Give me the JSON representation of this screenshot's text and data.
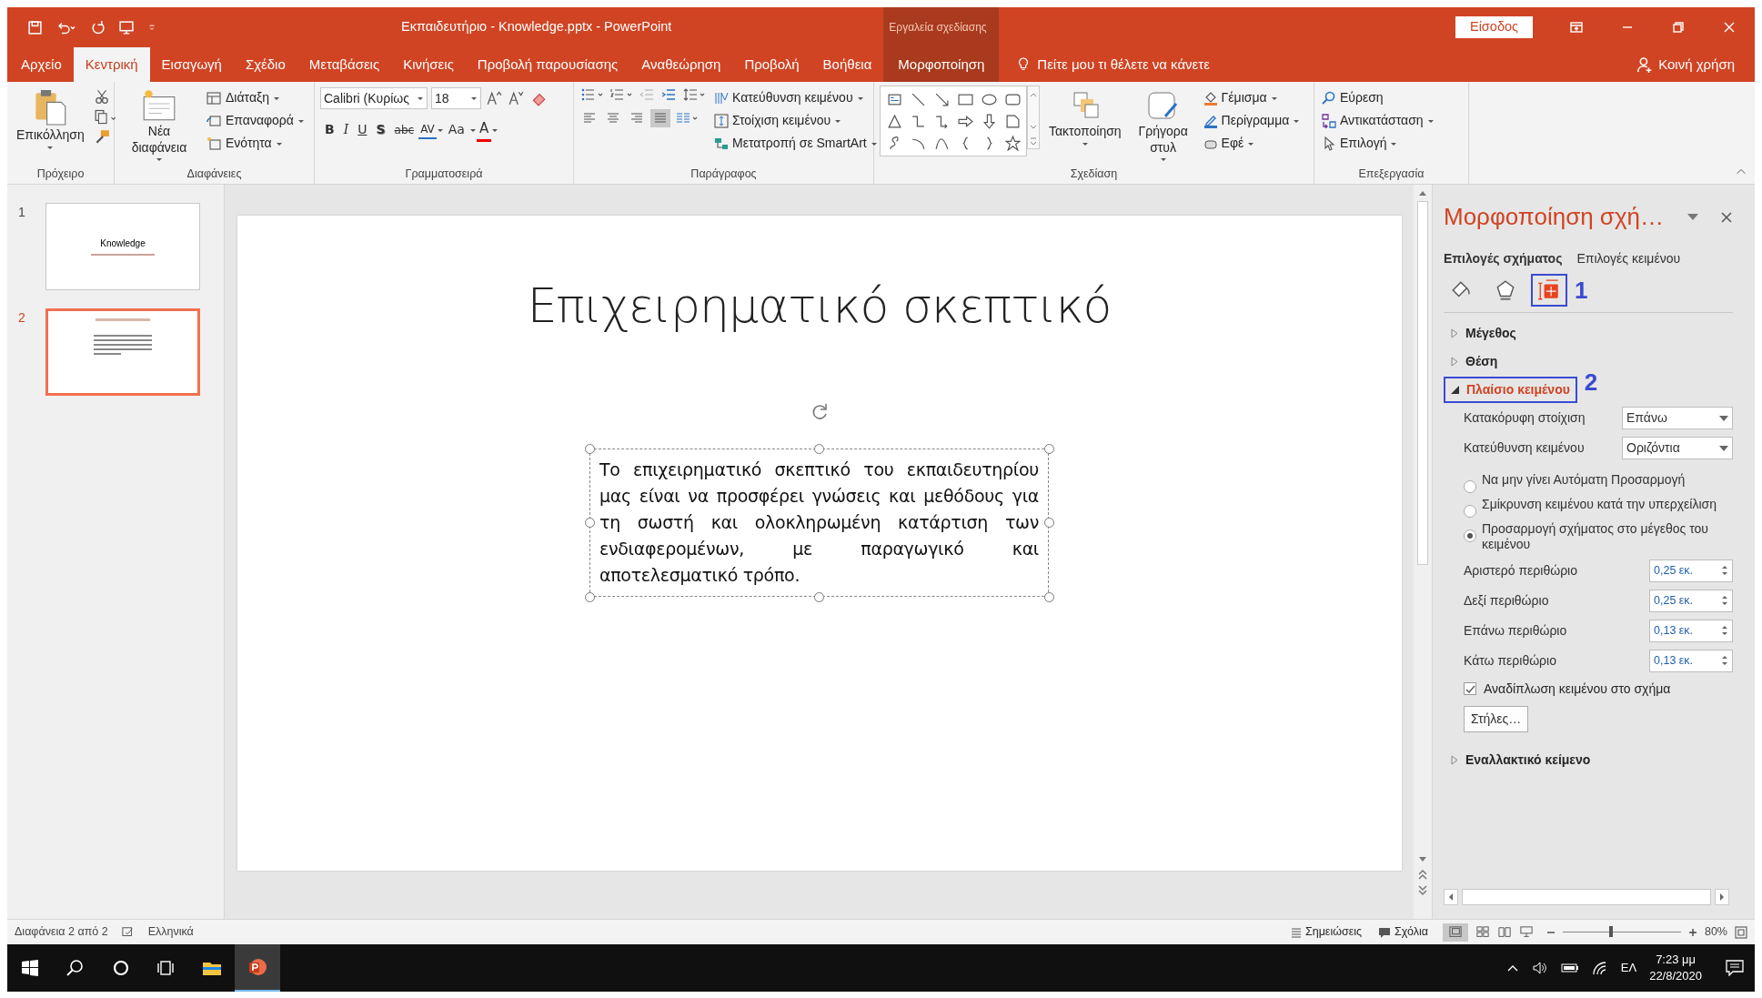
{
  "window": {
    "title": "Εκπαιδευτήριο - Knowledge.pptx  -  PowerPoint",
    "context_group": "Εργαλεία σχεδίασης",
    "sign_in": "Είσοδος"
  },
  "menu_tabs": [
    {
      "label": "Αρχείο",
      "selected": false,
      "kind": "normal"
    },
    {
      "label": "Κεντρική",
      "selected": true,
      "kind": "normal"
    },
    {
      "label": "Εισαγωγή",
      "selected": false,
      "kind": "normal"
    },
    {
      "label": "Σχέδιο",
      "selected": false,
      "kind": "normal"
    },
    {
      "label": "Μεταβάσεις",
      "selected": false,
      "kind": "normal"
    },
    {
      "label": "Κινήσεις",
      "selected": false,
      "kind": "normal"
    },
    {
      "label": "Προβολή παρουσίασης",
      "selected": false,
      "kind": "normal"
    },
    {
      "label": "Αναθεώρηση",
      "selected": false,
      "kind": "normal"
    },
    {
      "label": "Προβολή",
      "selected": false,
      "kind": "normal"
    },
    {
      "label": "Βοήθεια",
      "selected": false,
      "kind": "normal"
    },
    {
      "label": "Μορφοποίηση",
      "selected": false,
      "kind": "contextual"
    }
  ],
  "tell_me": "Πείτε μου τι θέλετε να κάνετε",
  "share": "Κοινή χρήση",
  "ribbon": {
    "clipboard": {
      "name": "Πρόχειρο",
      "paste": "Επικόλληση"
    },
    "slides": {
      "name": "Διαφάνειες",
      "new_slide": "Νέα διαφάνεια",
      "commands": [
        "Διάταξη",
        "Επαναφορά",
        "Ενότητα"
      ]
    },
    "font": {
      "name": "Γραμματοσειρά",
      "font_name": "Calibri (Κυρίως",
      "font_size": "18",
      "format_buttons": [
        {
          "label": "B",
          "kind": "bold"
        },
        {
          "label": "I",
          "kind": "italic"
        },
        {
          "label": "U",
          "kind": "underline"
        },
        {
          "label": "S",
          "kind": "shadow"
        },
        {
          "label": "abc",
          "kind": "strike"
        },
        {
          "label": "AV",
          "kind": "spacing"
        },
        {
          "label": "Aa",
          "kind": "case"
        },
        {
          "label": "A",
          "kind": "color"
        }
      ]
    },
    "paragraph": {
      "name": "Παράγραφος",
      "align_buttons": [
        {
          "selected": false
        },
        {
          "selected": false
        },
        {
          "selected": false
        },
        {
          "selected": true
        }
      ],
      "commands": [
        "Κατεύθυνση κειμένου",
        "Στοίχιση κειμένου",
        "Μετατροπή σε SmartArt"
      ]
    },
    "drawing": {
      "name": "Σχεδίαση",
      "arrange": "Τακτοποίηση",
      "quick_styles": "Γρήγορα στυλ",
      "commands": [
        "Γέμισμα",
        "Περίγραμμα",
        "Εφέ"
      ]
    },
    "editing": {
      "name": "Επεξεργασία",
      "commands": [
        "Εύρεση",
        "Αντικατάσταση",
        "Επιλογή"
      ]
    }
  },
  "slides": [
    {
      "number": "1",
      "selected": false,
      "title": "Knowledge"
    },
    {
      "number": "2",
      "selected": true
    }
  ],
  "slide": {
    "title": "Επιχειρηματικό σκεπτικό",
    "body": "Το επιχειρηματικό σκεπτικό του εκπαιδευτηρίου μας είναι να προσφέρει γνώσεις και μεθόδους για τη σωστή και ολοκληρωμένη κατάρτιση των ενδιαφερομένων, με παραγωγικό και αποτελεσματικό τρόπο."
  },
  "format_pane": {
    "title": "Μορφοποίηση σχή…",
    "tabs": [
      {
        "label": "Επιλογές σχήματος",
        "selected": true
      },
      {
        "label": "Επιλογές κειμένου",
        "selected": false
      }
    ],
    "icon_tabs": [
      {
        "kind": "fill",
        "selected": false
      },
      {
        "kind": "effects",
        "selected": false
      },
      {
        "kind": "size",
        "selected": true,
        "callout": "1"
      }
    ],
    "sections": [
      {
        "label": "Μέγεθος",
        "expanded": false
      },
      {
        "label": "Θέση",
        "expanded": false
      },
      {
        "label": "Πλαίσιο κειμένου",
        "expanded": true,
        "callout": "2"
      },
      {
        "label": "Εναλλακτικό κείμενο",
        "expanded": false
      }
    ],
    "text_box": {
      "dropdowns": [
        {
          "label": "Κατακόρυφη στοίχιση",
          "value": "Επάνω"
        },
        {
          "label": "Κατεύθυνση κειμένου",
          "value": "Οριζόντια"
        }
      ],
      "autofit": [
        {
          "label": "Να μην γίνει Αυτόματη Προσαρμογή",
          "selected": false
        },
        {
          "label": "Σμίκρυνση κειμένου κατά την υπερχείλιση",
          "selected": false
        },
        {
          "label": "Προσαρμογή σχήματος στο μέγεθος του κειμένου",
          "selected": true
        }
      ],
      "margins": [
        {
          "label": "Αριστερό περιθώριο",
          "value": "0,25 εκ."
        },
        {
          "label": "Δεξί περιθώριο",
          "value": "0,25 εκ."
        },
        {
          "label": "Επάνω περιθώριο",
          "value": "0,13 εκ."
        },
        {
          "label": "Κάτω περιθώριο",
          "value": "0,13 εκ."
        }
      ],
      "wrap": {
        "label": "Αναδίπλωση κειμένου στο σχήμα",
        "checked": true
      },
      "columns_button": "Στήλες…"
    }
  },
  "status_bar": {
    "slide_info": "Διαφάνεια 2 από 2",
    "language": "Ελληνικά",
    "notes": "Σημειώσεις",
    "comments": "Σχόλια",
    "zoom": "80%",
    "zoom_level": {
      "level": 0.41
    }
  },
  "taskbar": {
    "language": "ΕΛ",
    "time": "7:23 μμ",
    "date": "22/8/2020"
  }
}
